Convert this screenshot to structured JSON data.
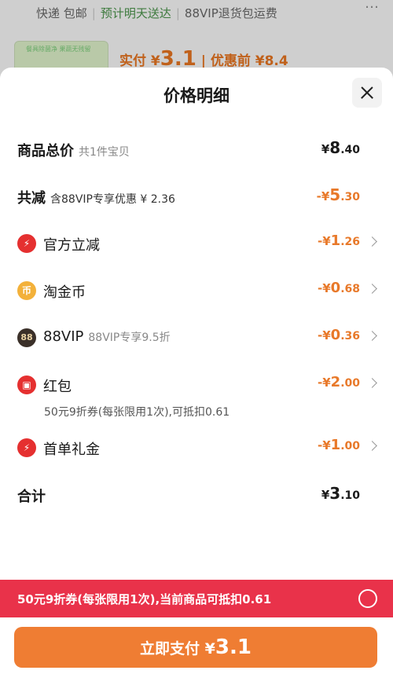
{
  "background": {
    "shipping": "快递 包邮",
    "delivery": "预计明天送达",
    "return_note": "88VIP退货包运费",
    "thumb_text": "餐具除菌净 果蔬无残留",
    "price_prefix": "实付 ¥",
    "price_value": "3.1",
    "price_before": "| 优惠前 ¥8.4",
    "more_icon": "more-dots-icon"
  },
  "sheet": {
    "title": "价格明细",
    "close_icon": "close-icon"
  },
  "rows": {
    "total": {
      "label": "商品总价",
      "sub": "共1件宝贝",
      "yen": "¥",
      "int": "8",
      "dec": ".40"
    },
    "reduce": {
      "label": "共减",
      "sub": "含88VIP专享优惠 ¥ 2.36",
      "yen": "-¥",
      "int": "5",
      "dec": ".30"
    },
    "official": {
      "label": "官方立减",
      "yen": "-¥",
      "int": "1",
      "dec": ".26",
      "icon": "lightning-icon"
    },
    "coin": {
      "label": "淘金币",
      "yen": "-¥",
      "int": "0",
      "dec": ".68",
      "icon": "coin-icon"
    },
    "vip": {
      "label": "88VIP",
      "sub": "88VIP专享9.5折",
      "yen": "-¥",
      "int": "0",
      "dec": ".36",
      "icon": "vip88-icon"
    },
    "redpack": {
      "label": "红包",
      "yen": "-¥",
      "int": "2",
      "dec": ".00",
      "note": "50元9折券(每张限用1次),可抵扣0.61",
      "icon": "red-envelope-icon"
    },
    "gift": {
      "label": "首单礼金",
      "yen": "-¥",
      "int": "1",
      "dec": ".00",
      "icon": "lightning-icon"
    },
    "sum": {
      "label": "合计",
      "yen": "¥",
      "int": "3",
      "dec": ".10"
    }
  },
  "banner": {
    "text": "50元9折券(每张限用1次),当前商品可抵扣0.61"
  },
  "pay": {
    "label": "立即支付 ¥",
    "value": "3.1"
  },
  "colors": {
    "accent": "#ef7d33",
    "discount": "#e8792a",
    "banner": "#e9324a"
  }
}
